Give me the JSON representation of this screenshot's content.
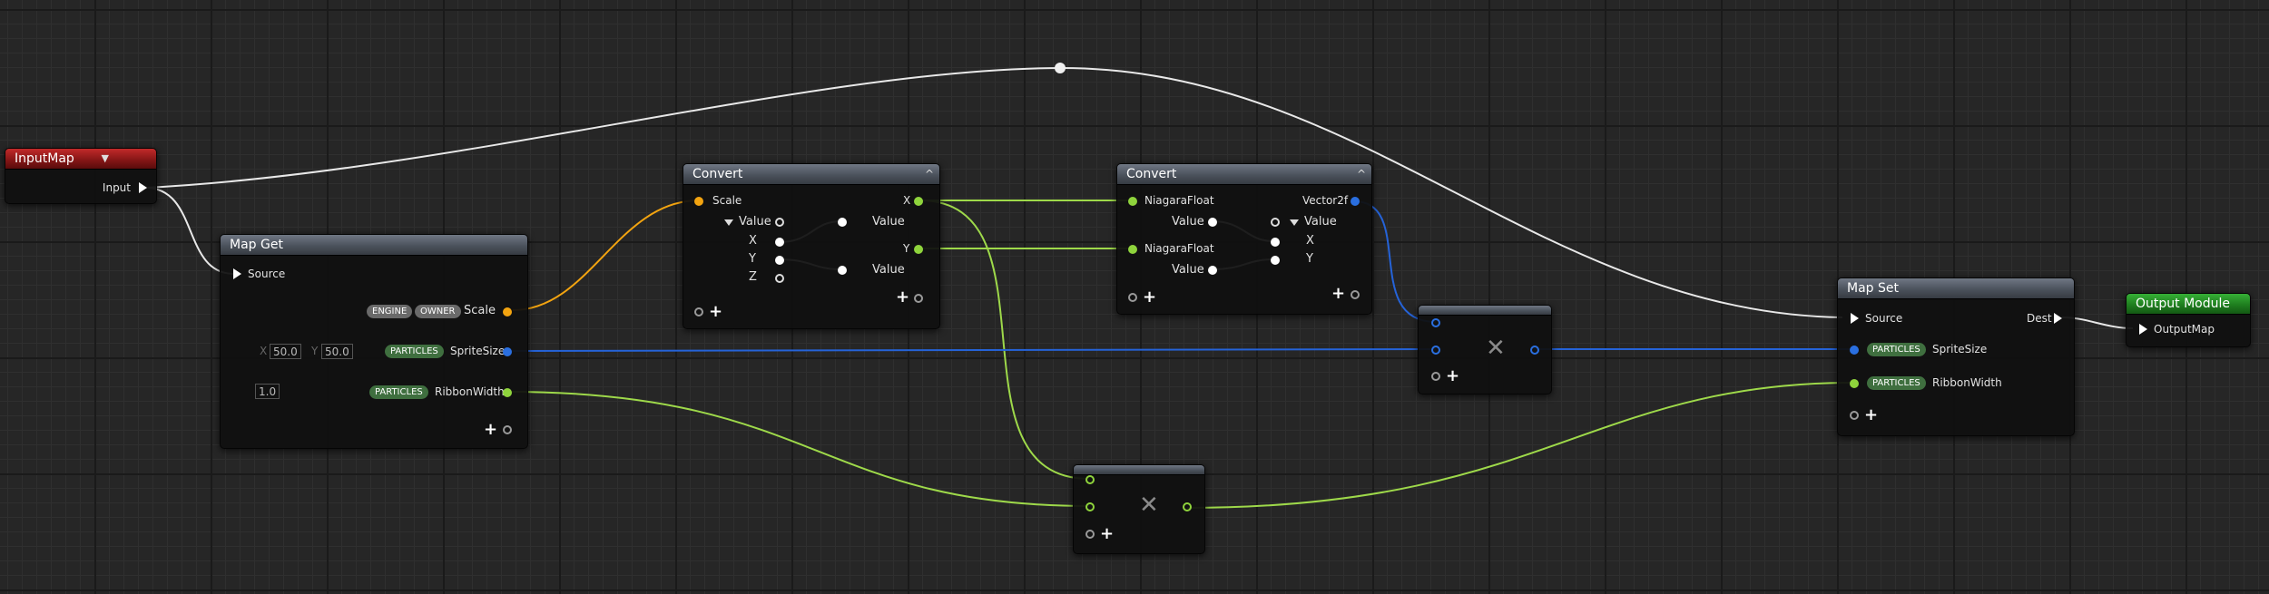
{
  "nodes": {
    "input_map": {
      "title": "InputMap",
      "pin_label": "Input"
    },
    "map_get": {
      "title": "Map Get",
      "source_label": "Source",
      "scale": {
        "tags": [
          "ENGINE",
          "OWNER"
        ],
        "label": "Scale"
      },
      "sprite_size": {
        "tag": "PARTICLES",
        "label": "SpriteSize",
        "x_axis": "X",
        "x_value": "50.0",
        "y_axis": "Y",
        "y_value": "50.0"
      },
      "ribbon_width": {
        "tag": "PARTICLES",
        "label": "RibbonWidth",
        "value": "1.0"
      }
    },
    "convert_1": {
      "title": "Convert",
      "in_label": "Scale",
      "value_label": "Value",
      "components": [
        "X",
        "Y",
        "Z"
      ],
      "out_value_1": "Value",
      "out_value_2": "Value",
      "out_x": "X",
      "out_y": "Y"
    },
    "convert_2": {
      "title": "Convert",
      "in_1": "NiagaraFloat",
      "in_2": "NiagaraFloat",
      "in_value_1": "Value",
      "in_value_2": "Value",
      "out_label": "Vector2f",
      "out_value": "Value",
      "out_components": [
        "X",
        "Y"
      ]
    },
    "map_set": {
      "title": "Map Set",
      "source_label": "Source",
      "dest_label": "Dest",
      "sprite_size": {
        "tag": "PARTICLES",
        "label": "SpriteSize"
      },
      "ribbon_width": {
        "tag": "PARTICLES",
        "label": "RibbonWidth"
      }
    },
    "output_module": {
      "title": "Output Module",
      "pin_label": "OutputMap"
    }
  },
  "icons": {
    "multiply": "multiply-icon",
    "add_pin": "add-pin-icon",
    "exec": "exec-pin-icon",
    "collapse": "collapse-arrow-icon"
  },
  "glyphs": {
    "plus": "+",
    "multiply": "✕",
    "collapse": "^"
  },
  "colors": {
    "wire_exec": "#e6e6e6",
    "wire_float": "#9ed94a",
    "wire_vector2": "#2563d8",
    "wire_vector": "#f3a410",
    "header_gray": "#4b525c",
    "header_red": "#821515",
    "header_green": "#1d7a1d"
  }
}
